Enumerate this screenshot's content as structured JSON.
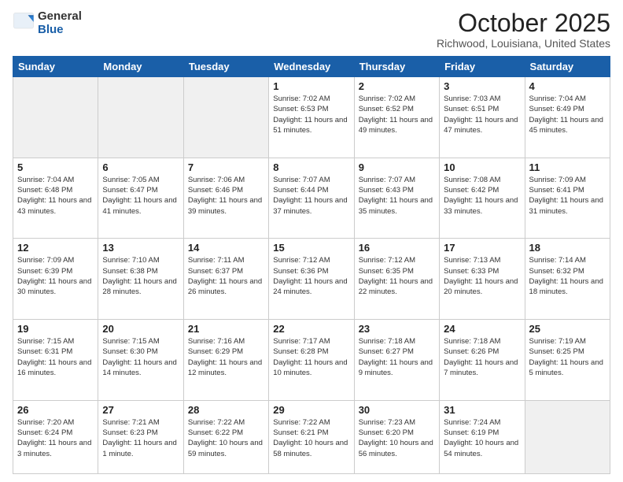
{
  "header": {
    "logo_general": "General",
    "logo_blue": "Blue",
    "month_title": "October 2025",
    "location": "Richwood, Louisiana, United States"
  },
  "weekdays": [
    "Sunday",
    "Monday",
    "Tuesday",
    "Wednesday",
    "Thursday",
    "Friday",
    "Saturday"
  ],
  "weeks": [
    [
      {
        "day": "",
        "info": ""
      },
      {
        "day": "",
        "info": ""
      },
      {
        "day": "",
        "info": ""
      },
      {
        "day": "1",
        "info": "Sunrise: 7:02 AM\nSunset: 6:53 PM\nDaylight: 11 hours\nand 51 minutes."
      },
      {
        "day": "2",
        "info": "Sunrise: 7:02 AM\nSunset: 6:52 PM\nDaylight: 11 hours\nand 49 minutes."
      },
      {
        "day": "3",
        "info": "Sunrise: 7:03 AM\nSunset: 6:51 PM\nDaylight: 11 hours\nand 47 minutes."
      },
      {
        "day": "4",
        "info": "Sunrise: 7:04 AM\nSunset: 6:49 PM\nDaylight: 11 hours\nand 45 minutes."
      }
    ],
    [
      {
        "day": "5",
        "info": "Sunrise: 7:04 AM\nSunset: 6:48 PM\nDaylight: 11 hours\nand 43 minutes."
      },
      {
        "day": "6",
        "info": "Sunrise: 7:05 AM\nSunset: 6:47 PM\nDaylight: 11 hours\nand 41 minutes."
      },
      {
        "day": "7",
        "info": "Sunrise: 7:06 AM\nSunset: 6:46 PM\nDaylight: 11 hours\nand 39 minutes."
      },
      {
        "day": "8",
        "info": "Sunrise: 7:07 AM\nSunset: 6:44 PM\nDaylight: 11 hours\nand 37 minutes."
      },
      {
        "day": "9",
        "info": "Sunrise: 7:07 AM\nSunset: 6:43 PM\nDaylight: 11 hours\nand 35 minutes."
      },
      {
        "day": "10",
        "info": "Sunrise: 7:08 AM\nSunset: 6:42 PM\nDaylight: 11 hours\nand 33 minutes."
      },
      {
        "day": "11",
        "info": "Sunrise: 7:09 AM\nSunset: 6:41 PM\nDaylight: 11 hours\nand 31 minutes."
      }
    ],
    [
      {
        "day": "12",
        "info": "Sunrise: 7:09 AM\nSunset: 6:39 PM\nDaylight: 11 hours\nand 30 minutes."
      },
      {
        "day": "13",
        "info": "Sunrise: 7:10 AM\nSunset: 6:38 PM\nDaylight: 11 hours\nand 28 minutes."
      },
      {
        "day": "14",
        "info": "Sunrise: 7:11 AM\nSunset: 6:37 PM\nDaylight: 11 hours\nand 26 minutes."
      },
      {
        "day": "15",
        "info": "Sunrise: 7:12 AM\nSunset: 6:36 PM\nDaylight: 11 hours\nand 24 minutes."
      },
      {
        "day": "16",
        "info": "Sunrise: 7:12 AM\nSunset: 6:35 PM\nDaylight: 11 hours\nand 22 minutes."
      },
      {
        "day": "17",
        "info": "Sunrise: 7:13 AM\nSunset: 6:33 PM\nDaylight: 11 hours\nand 20 minutes."
      },
      {
        "day": "18",
        "info": "Sunrise: 7:14 AM\nSunset: 6:32 PM\nDaylight: 11 hours\nand 18 minutes."
      }
    ],
    [
      {
        "day": "19",
        "info": "Sunrise: 7:15 AM\nSunset: 6:31 PM\nDaylight: 11 hours\nand 16 minutes."
      },
      {
        "day": "20",
        "info": "Sunrise: 7:15 AM\nSunset: 6:30 PM\nDaylight: 11 hours\nand 14 minutes."
      },
      {
        "day": "21",
        "info": "Sunrise: 7:16 AM\nSunset: 6:29 PM\nDaylight: 11 hours\nand 12 minutes."
      },
      {
        "day": "22",
        "info": "Sunrise: 7:17 AM\nSunset: 6:28 PM\nDaylight: 11 hours\nand 10 minutes."
      },
      {
        "day": "23",
        "info": "Sunrise: 7:18 AM\nSunset: 6:27 PM\nDaylight: 11 hours\nand 9 minutes."
      },
      {
        "day": "24",
        "info": "Sunrise: 7:18 AM\nSunset: 6:26 PM\nDaylight: 11 hours\nand 7 minutes."
      },
      {
        "day": "25",
        "info": "Sunrise: 7:19 AM\nSunset: 6:25 PM\nDaylight: 11 hours\nand 5 minutes."
      }
    ],
    [
      {
        "day": "26",
        "info": "Sunrise: 7:20 AM\nSunset: 6:24 PM\nDaylight: 11 hours\nand 3 minutes."
      },
      {
        "day": "27",
        "info": "Sunrise: 7:21 AM\nSunset: 6:23 PM\nDaylight: 11 hours\nand 1 minute."
      },
      {
        "day": "28",
        "info": "Sunrise: 7:22 AM\nSunset: 6:22 PM\nDaylight: 10 hours\nand 59 minutes."
      },
      {
        "day": "29",
        "info": "Sunrise: 7:22 AM\nSunset: 6:21 PM\nDaylight: 10 hours\nand 58 minutes."
      },
      {
        "day": "30",
        "info": "Sunrise: 7:23 AM\nSunset: 6:20 PM\nDaylight: 10 hours\nand 56 minutes."
      },
      {
        "day": "31",
        "info": "Sunrise: 7:24 AM\nSunset: 6:19 PM\nDaylight: 10 hours\nand 54 minutes."
      },
      {
        "day": "",
        "info": ""
      }
    ]
  ]
}
